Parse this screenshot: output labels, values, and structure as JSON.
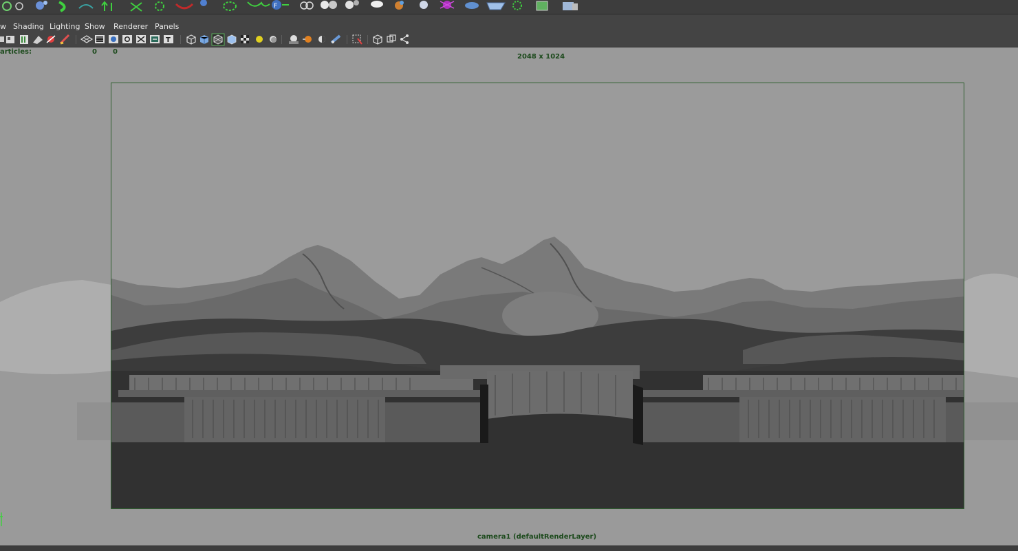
{
  "menu": {
    "view_partial": "w",
    "shading": "Shading",
    "lighting": "Lighting",
    "show": "Show",
    "renderer": "Renderer",
    "panels": "Panels"
  },
  "hud": {
    "particles_label": "articles:",
    "particles_value_1": "0",
    "particles_value_2": "0",
    "resolution": "2048 x 1024",
    "camera": "camera1 (defaultRenderLayer)"
  },
  "colors": {
    "hud_text": "#1c4a1c",
    "resolution_gate": "#2e5f2e",
    "viewport_bg": "#9a9a9a",
    "ui_panel": "#444444"
  },
  "shelf_icons": [
    "snap-icon",
    "move-sphere-icon",
    "curve-icon",
    "deform-icon",
    "arrows-icon",
    "cluster-icon",
    "lattice-icon",
    "emitter-icon",
    "field-icon",
    "rigid-body-icon",
    "fluid-icon",
    "spheres-icon",
    "particle-cloud-icon",
    "soft-body-icon",
    "smoke-icon",
    "fire-icon",
    "shatter-icon",
    "lightning-icon",
    "surface-icon",
    "flow-icon",
    "particle-sprite-icon",
    "cache-icon",
    "delete-icon"
  ],
  "toolbar_icons": [
    "camera-select-icon",
    "camera-attributes-icon",
    "bookmark-icon",
    "image-plane-icon",
    "2d-pan-icon",
    "grease-pencil-icon",
    "grid-icon",
    "film-gate-icon",
    "resolution-gate-icon",
    "gate-mask-icon",
    "field-chart-icon",
    "safe-action-icon",
    "safe-title-icon",
    "wireframe-icon",
    "smooth-shade-icon",
    "wireframe-on-shaded-icon",
    "flat-shade-icon",
    "texture-icon",
    "lights-icon",
    "shadows-icon",
    "screen-ao-icon",
    "motion-blur-icon",
    "anti-alias-icon",
    "depth-of-field-icon",
    "isolate-select-icon",
    "xray-icon",
    "xray-joints-icon",
    "xray-components-icon"
  ]
}
